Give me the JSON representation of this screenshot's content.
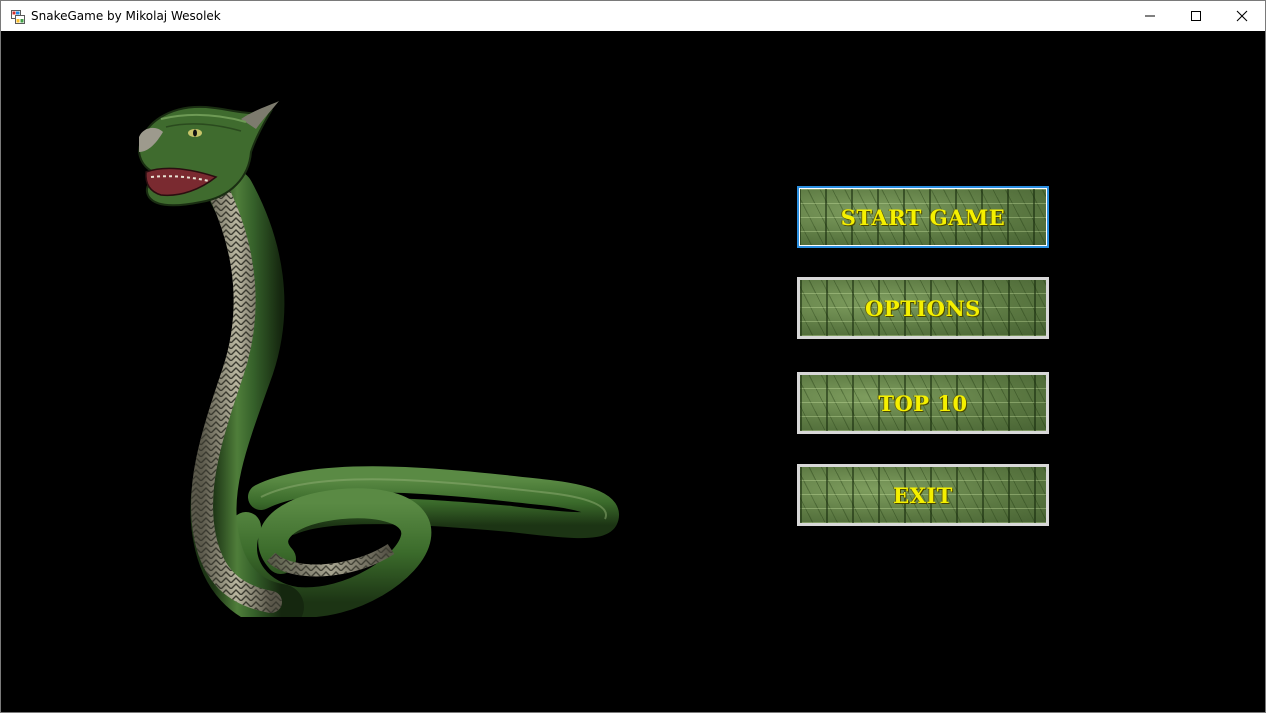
{
  "window": {
    "title": "SnakeGame by Mikolaj Wesolek",
    "icons": {
      "app": "app-form-icon",
      "minimize": "minimize-icon",
      "maximize": "maximize-icon",
      "close": "close-icon"
    }
  },
  "menu": {
    "start_label": "START GAME",
    "options_label": "OPTIONS",
    "top10_label": "TOP 10",
    "exit_label": "EXIT"
  },
  "colors": {
    "background": "#000000",
    "button_text": "#f5f000",
    "button_border": "#d8d8d8",
    "focus_border": "#2b8fe0",
    "snake_green": "#3f6b2e"
  },
  "illustration": {
    "subject": "coiled-green-snake-icon"
  }
}
